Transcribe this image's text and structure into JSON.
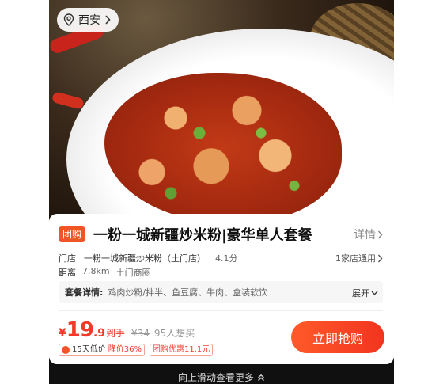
{
  "location": {
    "city": "西安"
  },
  "product": {
    "tag": "团购",
    "title": "一粉一城新疆炒米粉|豪华单人套餐",
    "detail_label": "详情"
  },
  "store": {
    "label": "门店",
    "name": "一粉一城新疆炒米粉（土门店）",
    "rating": "4.1分",
    "more_label": "1家店通用"
  },
  "distance": {
    "label": "距离",
    "value": "7.8km",
    "area": "土门商圈"
  },
  "combo": {
    "label": "套餐详情:",
    "items": "鸡肉炒粉/拌半、鱼豆腐、牛肉、盒装软饮",
    "expand_label": "展开"
  },
  "price": {
    "currency": "¥",
    "integer": "19",
    "decimal": ".9",
    "suffix": "到手",
    "original": "¥34",
    "sold": "95人想买"
  },
  "badges": {
    "low_price_prefix": "15天低价",
    "low_price_drop": "降价36%",
    "coupon": "团购优惠11.1元"
  },
  "buy_button": "立即抢购",
  "scroll_hint": "向上滑动查看更多",
  "colors": {
    "accent": "#f23a2a",
    "tag_bg": "#f2542a"
  }
}
